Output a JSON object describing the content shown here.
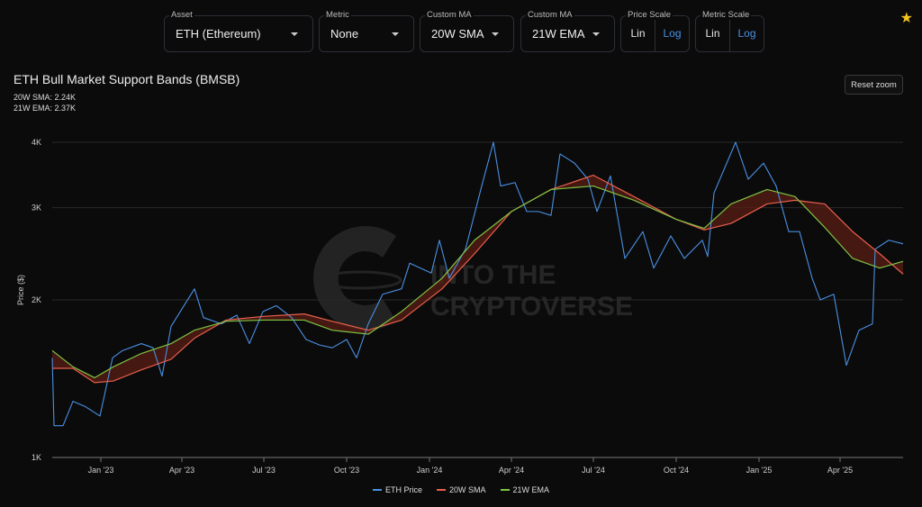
{
  "controls": {
    "asset": {
      "label": "Asset",
      "value": "ETH (Ethereum)"
    },
    "metric": {
      "label": "Metric",
      "value": "None"
    },
    "ma1": {
      "label": "Custom MA",
      "value": "20W SMA"
    },
    "ma2": {
      "label": "Custom MA",
      "value": "21W EMA"
    },
    "price_scale": {
      "label": "Price Scale",
      "options": [
        "Lin",
        "Log"
      ],
      "selected": "Log"
    },
    "metric_scale": {
      "label": "Metric Scale",
      "options": [
        "Lin",
        "Log"
      ],
      "selected": "Log"
    }
  },
  "reset_zoom": "Reset zoom",
  "stats": {
    "sma": "20W SMA: 2.24K",
    "ema": "21W EMA: 2.37K"
  },
  "watermark": [
    "INTO THE",
    "CRYPTOVERSE"
  ],
  "colors": {
    "price": "#4a90e2",
    "sma": "#e8604c",
    "ema": "#7ec443",
    "band": "#5a1e14",
    "accent": "#4a90e2"
  },
  "chart_data": {
    "type": "line",
    "title": "ETH Bull Market Support Bands (BMSB)",
    "ylabel": "Price ($)",
    "yscale": "log",
    "ylim": [
      1000,
      4000
    ],
    "yticks": [
      {
        "v": 1000,
        "label": "1K"
      },
      {
        "v": 2000,
        "label": "2K"
      },
      {
        "v": 3000,
        "label": "3K"
      },
      {
        "v": 4000,
        "label": "4K"
      }
    ],
    "xlim": [
      "2022-11-08",
      "2025-06-10"
    ],
    "xticks": [
      {
        "d": "2023-01-01",
        "label": "Jan '23"
      },
      {
        "d": "2023-04-01",
        "label": "Apr '23"
      },
      {
        "d": "2023-07-01",
        "label": "Jul '23"
      },
      {
        "d": "2023-10-01",
        "label": "Oct '23"
      },
      {
        "d": "2024-01-01",
        "label": "Jan '24"
      },
      {
        "d": "2024-04-01",
        "label": "Apr '24"
      },
      {
        "d": "2024-07-01",
        "label": "Jul '24"
      },
      {
        "d": "2024-10-01",
        "label": "Oct '24"
      },
      {
        "d": "2025-01-01",
        "label": "Jan '25"
      },
      {
        "d": "2025-04-01",
        "label": "Apr '25"
      }
    ],
    "legend": {
      "placement": "bottom-center",
      "entries": [
        "ETH Price",
        "20W SMA",
        "21W EMA"
      ]
    },
    "series": [
      {
        "name": "ETH Price",
        "points": [
          [
            "2022-11-08",
            1550
          ],
          [
            "2022-11-10",
            1150
          ],
          [
            "2022-11-20",
            1150
          ],
          [
            "2022-12-01",
            1280
          ],
          [
            "2022-12-15",
            1250
          ],
          [
            "2022-12-31",
            1200
          ],
          [
            "2023-01-14",
            1550
          ],
          [
            "2023-01-25",
            1600
          ],
          [
            "2023-02-15",
            1650
          ],
          [
            "2023-02-28",
            1620
          ],
          [
            "2023-03-10",
            1430
          ],
          [
            "2023-03-20",
            1780
          ],
          [
            "2023-04-15",
            2100
          ],
          [
            "2023-04-25",
            1850
          ],
          [
            "2023-05-15",
            1800
          ],
          [
            "2023-06-01",
            1870
          ],
          [
            "2023-06-15",
            1650
          ],
          [
            "2023-06-30",
            1900
          ],
          [
            "2023-07-15",
            1950
          ],
          [
            "2023-08-01",
            1850
          ],
          [
            "2023-08-17",
            1680
          ],
          [
            "2023-09-01",
            1640
          ],
          [
            "2023-09-15",
            1620
          ],
          [
            "2023-10-01",
            1680
          ],
          [
            "2023-10-12",
            1550
          ],
          [
            "2023-10-25",
            1800
          ],
          [
            "2023-11-10",
            2050
          ],
          [
            "2023-12-01",
            2100
          ],
          [
            "2023-12-10",
            2350
          ],
          [
            "2024-01-03",
            2250
          ],
          [
            "2024-01-12",
            2600
          ],
          [
            "2024-01-23",
            2200
          ],
          [
            "2024-02-10",
            2500
          ],
          [
            "2024-02-28",
            3300
          ],
          [
            "2024-03-12",
            4000
          ],
          [
            "2024-03-20",
            3300
          ],
          [
            "2024-04-05",
            3350
          ],
          [
            "2024-04-18",
            2950
          ],
          [
            "2024-05-01",
            2950
          ],
          [
            "2024-05-15",
            2900
          ],
          [
            "2024-05-25",
            3800
          ],
          [
            "2024-06-10",
            3650
          ],
          [
            "2024-06-25",
            3400
          ],
          [
            "2024-07-05",
            2950
          ],
          [
            "2024-07-20",
            3450
          ],
          [
            "2024-08-05",
            2400
          ],
          [
            "2024-08-25",
            2700
          ],
          [
            "2024-09-06",
            2300
          ],
          [
            "2024-09-25",
            2650
          ],
          [
            "2024-10-10",
            2400
          ],
          [
            "2024-10-30",
            2600
          ],
          [
            "2024-11-05",
            2420
          ],
          [
            "2024-11-12",
            3200
          ],
          [
            "2024-12-06",
            4000
          ],
          [
            "2024-12-20",
            3400
          ],
          [
            "2025-01-06",
            3650
          ],
          [
            "2025-01-20",
            3300
          ],
          [
            "2025-02-03",
            2700
          ],
          [
            "2025-02-15",
            2700
          ],
          [
            "2025-03-01",
            2200
          ],
          [
            "2025-03-10",
            2000
          ],
          [
            "2025-03-25",
            2050
          ],
          [
            "2025-04-08",
            1500
          ],
          [
            "2025-04-22",
            1750
          ],
          [
            "2025-05-07",
            1800
          ],
          [
            "2025-05-10",
            2500
          ],
          [
            "2025-05-25",
            2600
          ],
          [
            "2025-06-10",
            2560
          ]
        ]
      },
      {
        "name": "20W SMA",
        "points": [
          [
            "2022-11-08",
            1480
          ],
          [
            "2022-12-01",
            1480
          ],
          [
            "2022-12-25",
            1390
          ],
          [
            "2023-01-15",
            1400
          ],
          [
            "2023-02-15",
            1470
          ],
          [
            "2023-03-20",
            1540
          ],
          [
            "2023-04-15",
            1690
          ],
          [
            "2023-05-20",
            1830
          ],
          [
            "2023-07-01",
            1860
          ],
          [
            "2023-08-15",
            1880
          ],
          [
            "2023-09-15",
            1820
          ],
          [
            "2023-10-25",
            1750
          ],
          [
            "2023-12-01",
            1830
          ],
          [
            "2024-01-15",
            2100
          ],
          [
            "2024-02-20",
            2450
          ],
          [
            "2024-04-01",
            2950
          ],
          [
            "2024-05-15",
            3250
          ],
          [
            "2024-07-01",
            3460
          ],
          [
            "2024-08-15",
            3150
          ],
          [
            "2024-10-01",
            2850
          ],
          [
            "2024-11-01",
            2720
          ],
          [
            "2024-12-01",
            2800
          ],
          [
            "2025-01-10",
            3050
          ],
          [
            "2025-02-10",
            3100
          ],
          [
            "2025-03-15",
            3050
          ],
          [
            "2025-04-15",
            2700
          ],
          [
            "2025-05-15",
            2450
          ],
          [
            "2025-06-10",
            2240
          ]
        ]
      },
      {
        "name": "21W EMA",
        "points": [
          [
            "2022-11-08",
            1600
          ],
          [
            "2022-12-01",
            1490
          ],
          [
            "2022-12-25",
            1420
          ],
          [
            "2023-01-15",
            1490
          ],
          [
            "2023-02-15",
            1580
          ],
          [
            "2023-03-20",
            1650
          ],
          [
            "2023-04-15",
            1750
          ],
          [
            "2023-05-20",
            1820
          ],
          [
            "2023-07-01",
            1830
          ],
          [
            "2023-08-15",
            1830
          ],
          [
            "2023-09-15",
            1750
          ],
          [
            "2023-10-25",
            1720
          ],
          [
            "2023-12-01",
            1900
          ],
          [
            "2024-01-15",
            2200
          ],
          [
            "2024-02-20",
            2600
          ],
          [
            "2024-04-01",
            2950
          ],
          [
            "2024-05-15",
            3250
          ],
          [
            "2024-07-01",
            3300
          ],
          [
            "2024-08-15",
            3100
          ],
          [
            "2024-10-01",
            2850
          ],
          [
            "2024-11-01",
            2740
          ],
          [
            "2024-12-01",
            3050
          ],
          [
            "2025-01-10",
            3250
          ],
          [
            "2025-02-10",
            3150
          ],
          [
            "2025-03-15",
            2750
          ],
          [
            "2025-04-15",
            2400
          ],
          [
            "2025-05-15",
            2300
          ],
          [
            "2025-06-10",
            2370
          ]
        ]
      }
    ]
  }
}
